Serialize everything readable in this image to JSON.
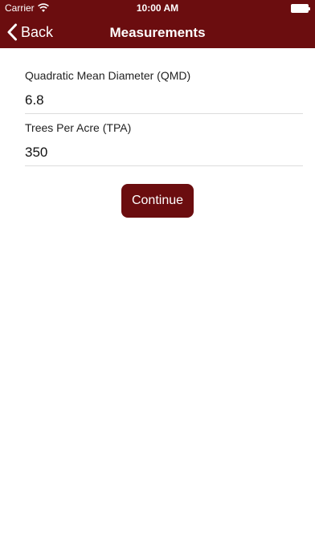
{
  "status_bar": {
    "carrier": "Carrier",
    "time": "10:00 AM",
    "wifi_icon": "wifi-icon",
    "battery_icon": "battery-icon"
  },
  "nav": {
    "back_label": "Back",
    "back_icon": "chevron-left-icon",
    "title": "Measurements"
  },
  "fields": [
    {
      "label": "Quadratic Mean Diameter (QMD)",
      "value": "6.8"
    },
    {
      "label": "Trees Per Acre (TPA)",
      "value": "350"
    }
  ],
  "continue_label": "Continue",
  "colors": {
    "brand": "#6b0d0f",
    "background": "#ffffff",
    "divider": "#dcdcdc"
  }
}
